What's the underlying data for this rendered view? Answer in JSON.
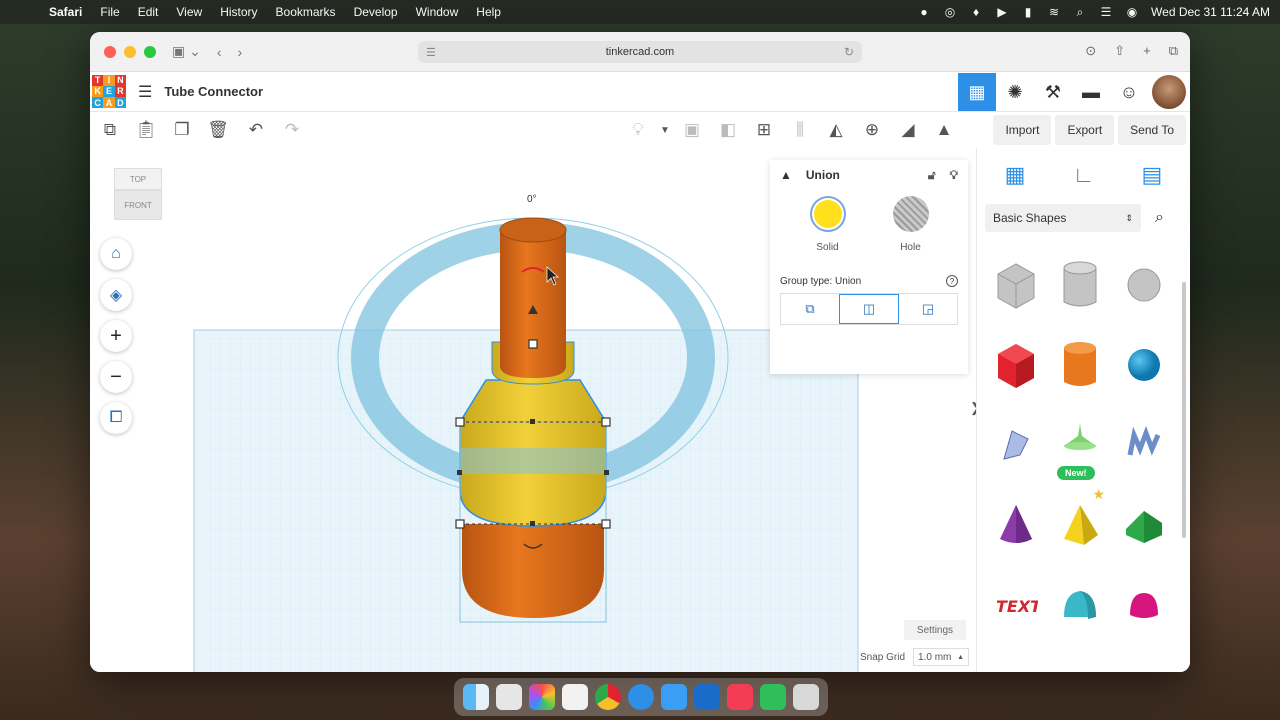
{
  "menubar": {
    "app_name": "Safari",
    "menus": [
      "File",
      "Edit",
      "View",
      "History",
      "Bookmarks",
      "Develop",
      "Window",
      "Help"
    ],
    "datetime": "Wed Dec 31  11:24 AM"
  },
  "browser": {
    "url": "tinkercad.com"
  },
  "header": {
    "title": "Tube Connector"
  },
  "toolbar": {
    "import_label": "Import",
    "export_label": "Export",
    "send_to_label": "Send To"
  },
  "viewcube": {
    "top_label": "TOP",
    "front_label": "FRONT"
  },
  "scene": {
    "rotation_label": "0°"
  },
  "inspector": {
    "title": "Union",
    "solid_label": "Solid",
    "hole_label": "Hole",
    "group_type_label": "Group type: Union",
    "solid_color": "#FFE01A"
  },
  "workspace": {
    "settings_label": "Settings",
    "snap_grid_label": "Snap Grid",
    "snap_grid_value": "1.0 mm"
  },
  "shapes_panel": {
    "library": "Basic Shapes",
    "new_badge": "New!",
    "shapes": [
      {
        "name": "box-hole",
        "color": "#b8b8b8"
      },
      {
        "name": "cylinder-hole",
        "color": "#b8b8b8"
      },
      {
        "name": "sphere-hole",
        "color": "#b8b8b8"
      },
      {
        "name": "box",
        "color": "#e0232e"
      },
      {
        "name": "cylinder",
        "color": "#e8771e"
      },
      {
        "name": "sphere",
        "color": "#1c9fd8"
      },
      {
        "name": "scribble",
        "color": "#8aa0d8"
      },
      {
        "name": "spinning-top",
        "color": "#7bd36d"
      },
      {
        "name": "text-shape",
        "color": "#6b8ec8"
      },
      {
        "name": "cone",
        "color": "#8e3aa8"
      },
      {
        "name": "pyramid",
        "color": "#f5d21e"
      },
      {
        "name": "roof",
        "color": "#2ea94a"
      },
      {
        "name": "text",
        "color": "#d0282e"
      },
      {
        "name": "half-cylinder",
        "color": "#3bb8c8"
      },
      {
        "name": "paraboloid",
        "color": "#d8147e"
      }
    ]
  },
  "colors": {
    "accent": "#2E8FE6",
    "orange": "#E8771E",
    "yellow": "#F2D03A"
  }
}
